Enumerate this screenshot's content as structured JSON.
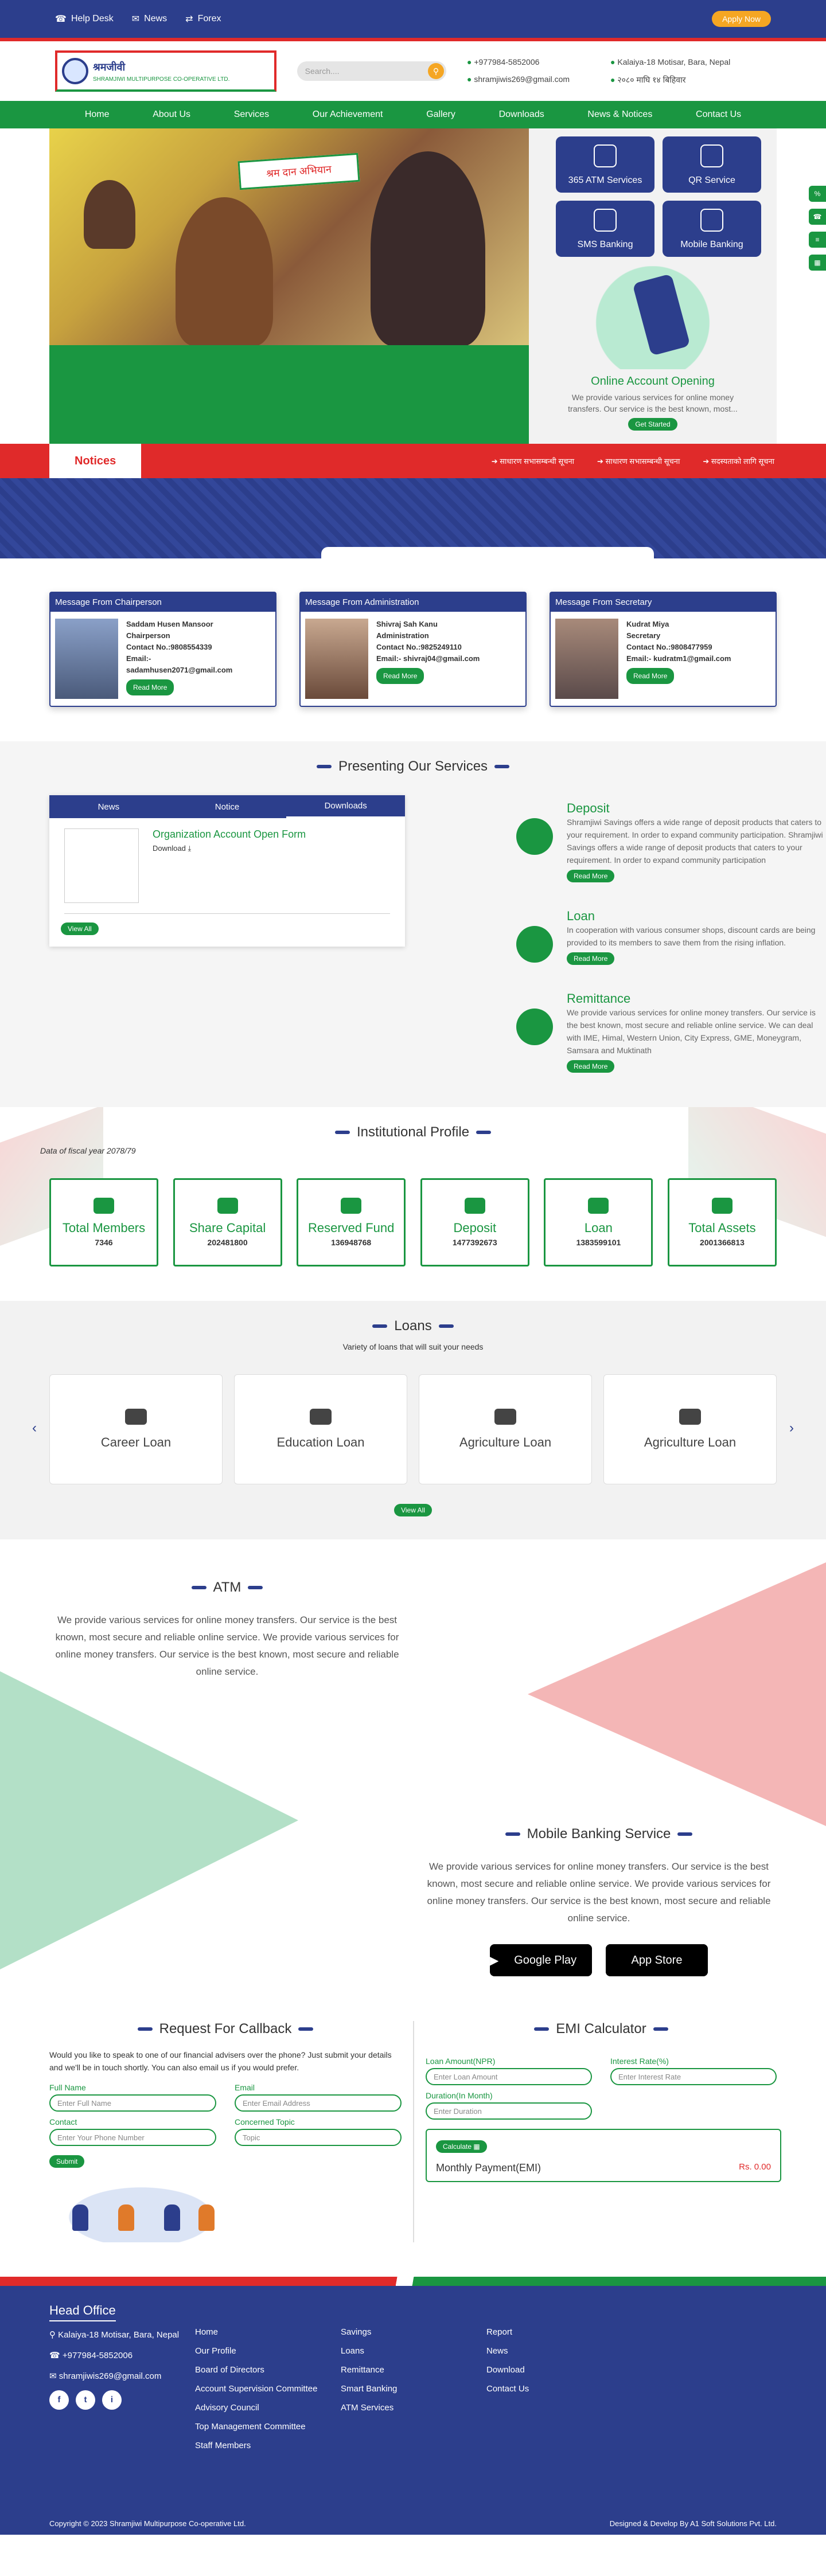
{
  "topbar": {
    "links": [
      "Help Desk",
      "News",
      "Forex"
    ],
    "apply": "Apply Now"
  },
  "header": {
    "logo_line1": "श्रमजीवी",
    "logo_line2": "SHRAMJIWI MULTIPURPOSE CO-OPERATIVE LTD.",
    "search_placeholder": "Search....",
    "phone": "+977984-5852006",
    "address": "Kalaiya-18 Motisar, Bara, Nepal",
    "email": "shramjiwis269@gmail.com",
    "hours": "२०८० माघि १४ बिहिवार"
  },
  "nav": [
    "Home",
    "About Us",
    "Services",
    "Our Achievement",
    "Gallery",
    "Downloads",
    "News & Notices",
    "Contact Us"
  ],
  "hero": {
    "banner": "श्रम दान अभियान",
    "tiles": [
      "365 ATM Services",
      "QR Service",
      "SMS Banking",
      "Mobile Banking"
    ],
    "online_title": "Online Account Opening",
    "online_text": "We provide various services for online money transfers. Our service is the best known, most...",
    "get_started": "Get Started"
  },
  "notices": {
    "label": "Notices",
    "items": [
      "साधारण सभासम्बन्धी सूचना",
      "साधारण सभासम्बन्धी सूचना",
      "सदस्यताको लागि सूचना"
    ]
  },
  "messages": [
    {
      "head": "Message From Chairperson",
      "name": "Saddam Husen Mansoor",
      "role": "Chairperson",
      "contact": "Contact No.:9808554339",
      "email_label": "Email:-",
      "email": "sadamhusen2071@gmail.com",
      "btn": "Read More"
    },
    {
      "head": "Message From Administration",
      "name": "Shivraj Sah Kanu",
      "role": "Administration",
      "contact": "Contact No.:9825249110",
      "email_label": "Email:-",
      "email": "shivraj04@gmail.com",
      "btn": "Read More"
    },
    {
      "head": "Message From Secretary",
      "name": "Kudrat Miya",
      "role": "Secretary",
      "contact": "Contact No.:9808477959",
      "email_label": "Email:-",
      "email": "kudratm1@gmail.com",
      "btn": "Read More"
    }
  ],
  "services": {
    "title": "Presenting Our Services",
    "tabs": [
      "News",
      "Notice",
      "Downloads"
    ],
    "doc_title": "Organization Account Open Form",
    "doc_download": "Download",
    "view_all": "View All",
    "items": [
      {
        "title": "Deposit",
        "text": "Shramjiwi Savings offers a wide range of deposit products that caters to your requirement. In order to expand community participation. Shramjiwi Savings offers a wide range of deposit products that caters to your requirement. In order to expand community participation",
        "btn": "Read More"
      },
      {
        "title": "Loan",
        "text": "In cooperation with various consumer shops, discount cards are being provided to its members to save them from the rising inflation.",
        "btn": "Read More"
      },
      {
        "title": "Remittance",
        "text": "We provide various services for online money transfers. Our service is the best known, most secure and reliable online service. We can deal with IME, Himal, Western Union, City Express, GME, Moneygram, Samsara and Muktinath",
        "btn": "Read More"
      }
    ]
  },
  "institutional": {
    "title": "Institutional Profile",
    "fiscal": "Data of fiscal year 2078/79",
    "stats": [
      {
        "label": "Total Members",
        "value": "7346"
      },
      {
        "label": "Share Capital",
        "value": "202481800"
      },
      {
        "label": "Reserved Fund",
        "value": "136948768"
      },
      {
        "label": "Deposit",
        "value": "1477392673"
      },
      {
        "label": "Loan",
        "value": "1383599101"
      },
      {
        "label": "Total Assets",
        "value": "2001366813"
      }
    ]
  },
  "loans": {
    "title": "Loans",
    "sub": "Variety of loans that will suit your needs",
    "cards": [
      "Career Loan",
      "Education Loan",
      "Agriculture Loan",
      "Agriculture Loan"
    ],
    "view_all": "View All"
  },
  "atm": {
    "title": "ATM",
    "text": "We provide various services for online money transfers. Our service is the best known, most secure and reliable online service. We provide various services for online money transfers. Our service is the best known, most secure and reliable online service."
  },
  "mobile": {
    "title": "Mobile Banking Service",
    "text": "We provide various services for online money transfers. Our service is the best known, most secure and reliable online service. We provide various services for online money transfers. Our service is the best known, most secure and reliable online service.",
    "gplay": "Google Play",
    "appstore": "App Store"
  },
  "callback": {
    "title": "Request For Callback",
    "text": "Would you like to speak to one of our financial advisers over the phone? Just submit your details and we'll be in touch shortly. You can also email us if you would prefer.",
    "fields": [
      {
        "label": "Full Name",
        "placeholder": "Enter Full Name"
      },
      {
        "label": "Email",
        "placeholder": "Enter Email Address"
      },
      {
        "label": "Contact",
        "placeholder": "Enter Your Phone Number"
      },
      {
        "label": "Concerned Topic",
        "placeholder": "Topic"
      }
    ],
    "submit": "Submit"
  },
  "emi": {
    "title": "EMI Calculator",
    "fields": [
      {
        "label": "Loan Amount(NPR)",
        "placeholder": "Enter Loan Amount"
      },
      {
        "label": "Interest Rate(%)",
        "placeholder": "Enter Interest Rate"
      },
      {
        "label": "Duration(In Month)",
        "placeholder": "Enter Duration"
      }
    ],
    "calc": "Calculate",
    "result_label": "Monthly Payment(EMI)",
    "result_value": "Rs. 0.00"
  },
  "footer": {
    "title": "Head Office",
    "address": "Kalaiya-18 Motisar, Bara, Nepal",
    "phone": "+977984-5852006",
    "email": "shramjiwis269@gmail.com",
    "social": [
      "f",
      "t",
      "i"
    ],
    "col1": [
      "Home",
      "Our Profile",
      "Board of Directors",
      "Account Supervision Committee",
      "Advisory Council",
      "Top Management Committee",
      "Staff Members"
    ],
    "col2": [
      "Savings",
      "Loans",
      "Remittance",
      "Smart Banking",
      "ATM Services"
    ],
    "col3": [
      "Report",
      "News",
      "Download",
      "Contact Us"
    ],
    "copyright": "Copyright © 2023 Shramjiwi Multipurpose Co-operative Ltd.",
    "credit": "Designed & Develop By A1 Soft Solutions Pvt. Ltd."
  }
}
